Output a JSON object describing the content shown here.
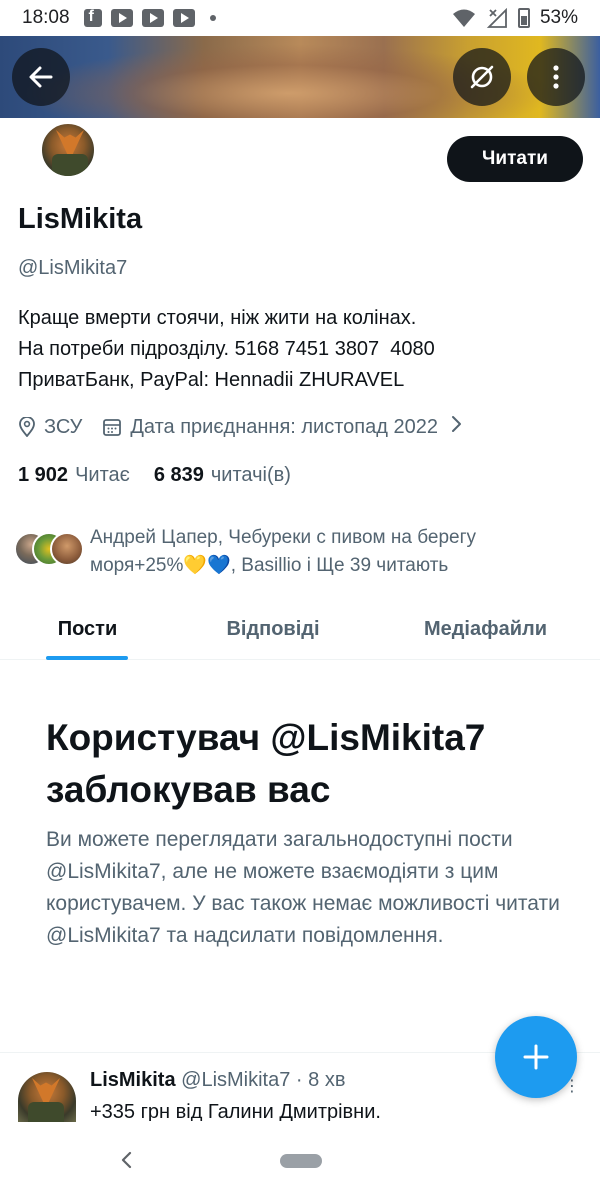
{
  "status_bar": {
    "time": "18:08",
    "battery": "53%",
    "app_icons": [
      "facebook-icon",
      "youtube-icon",
      "youtube-icon",
      "youtube-icon"
    ]
  },
  "header": {
    "back_icon": "arrow-left-icon",
    "grok_icon": "grok-icon",
    "more_icon": "more-vertical-icon"
  },
  "profile": {
    "follow_button": "Читати",
    "display_name": "LisMikita",
    "handle": "@LisMikita7",
    "bio_lines": [
      "Краще вмерти стоячи, ніж жити на колінах.",
      "На потреби підрозділу. 5168 7451 3807  4080",
      "ПриватБанк, PayPal: Hennadii ZHURAVEL"
    ],
    "location": "ЗСУ",
    "joined": "Дата приєднання: листопад 2022",
    "following_count": "1 902",
    "following_label": "Читає",
    "followers_count": "6 839",
    "followers_label": "читачі(в)",
    "followers_you_know": "Андрей Цапер, Чебуреки с пивом на берегу моря+25%💛💙, Basillio і Ще 39 читають"
  },
  "tabs": [
    {
      "label": "Пости",
      "active": true
    },
    {
      "label": "Відповіді",
      "active": false
    },
    {
      "label": "Медіафайли",
      "active": false
    }
  ],
  "blocked": {
    "title": "Користувач @LisMikita7 заблокував вас",
    "description": "Ви можете переглядати загальнодоступні пости @LisMikita7, але не можете взаємодіяти з цим користувачем. У вас також немає можливості читати @LisMikita7 та надсилати повідомлення."
  },
  "tweet": {
    "name": "LisMikita",
    "handle_time": "@LisMikita7 · 8 хв",
    "text": "+335 грн від Галини Дмитрівни."
  },
  "colors": {
    "accent": "#1d9bf0",
    "text_primary": "#0f1419",
    "text_secondary": "#536471"
  }
}
